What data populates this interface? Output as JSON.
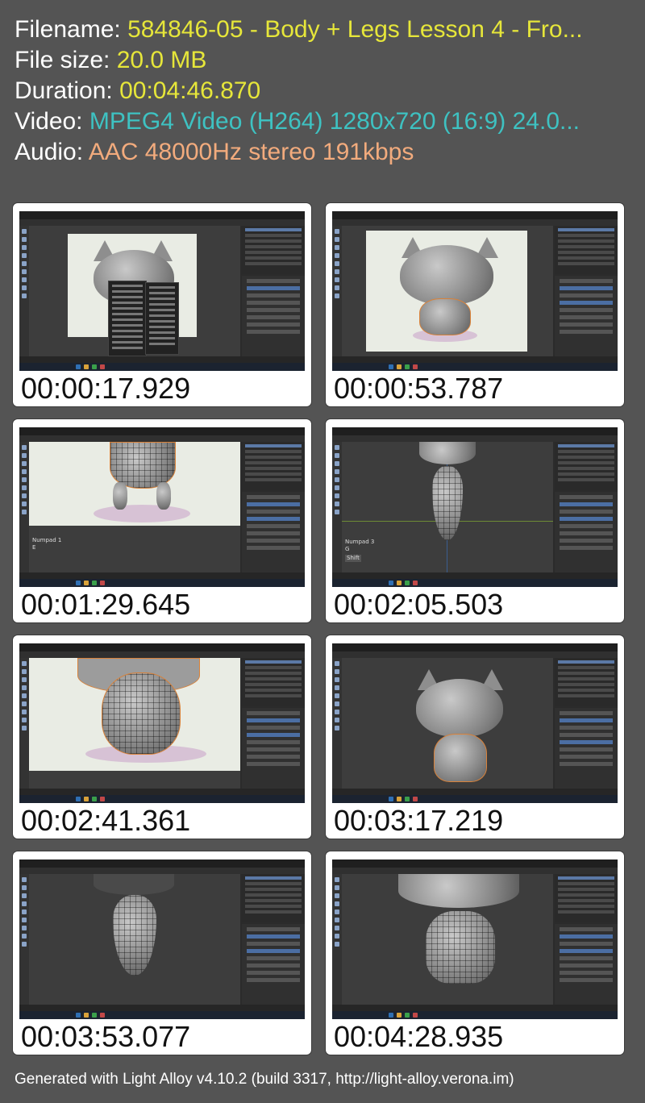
{
  "info": {
    "filename_label": "Filename:",
    "filename_value": "584846-05 - Body + Legs Lesson 4 - Fro...",
    "filesize_label": "File size:",
    "filesize_value": "20.0 MB",
    "duration_label": "Duration:",
    "duration_value": "00:04:46.870",
    "video_label": "Video:",
    "video_value": "MPEG4 Video (H264) 1280x720 (16:9) 24.0...",
    "audio_label": "Audio:",
    "audio_value": "AAC 48000Hz stereo 191kbps"
  },
  "thumbnails": [
    {
      "timestamp": "00:00:17.929"
    },
    {
      "timestamp": "00:00:53.787"
    },
    {
      "timestamp": "00:01:29.645",
      "key_hint_1": "Numpad 1",
      "key_hint_2": "E"
    },
    {
      "timestamp": "00:02:05.503",
      "key_hint_1": "Numpad 3",
      "key_hint_2": "G",
      "key_hint_3": "Shift"
    },
    {
      "timestamp": "00:02:41.361"
    },
    {
      "timestamp": "00:03:17.219"
    },
    {
      "timestamp": "00:03:53.077"
    },
    {
      "timestamp": "00:04:28.935"
    }
  ],
  "footer": "Generated with Light Alloy v4.10.2 (build 3317, http://light-alloy.verona.im)",
  "colors": {
    "background": "#545454",
    "label": "#ffffff",
    "filename": "#e6e63a",
    "video": "#3ec2c2",
    "audio": "#f2ab7d"
  }
}
